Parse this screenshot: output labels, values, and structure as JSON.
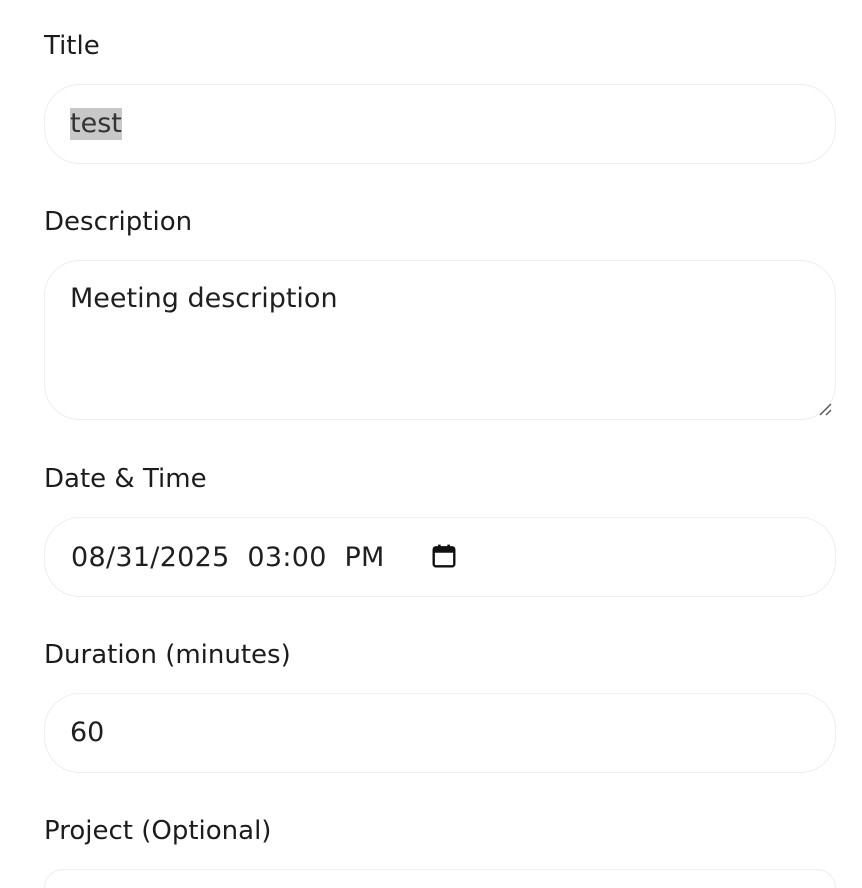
{
  "form": {
    "title": {
      "label": "Title",
      "value": "test"
    },
    "description": {
      "label": "Description",
      "value": "Meeting description"
    },
    "datetime": {
      "label": "Date & Time",
      "value": "08/31/2025  03:00  PM",
      "icon": "calendar-icon"
    },
    "duration": {
      "label": "Duration (minutes)",
      "value": "60"
    },
    "project": {
      "label": "Project (Optional)"
    }
  }
}
